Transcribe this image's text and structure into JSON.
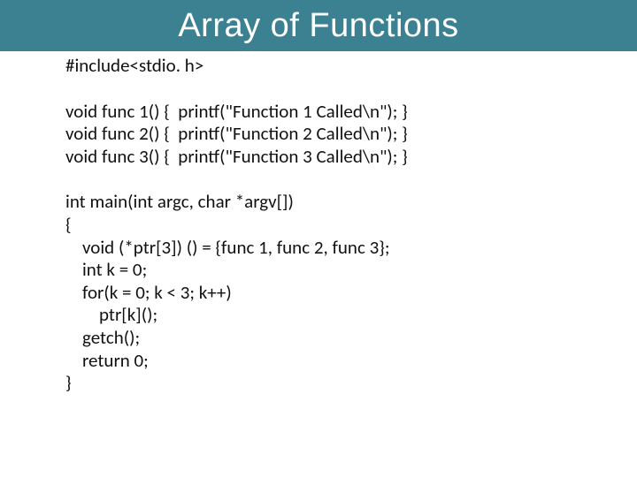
{
  "title": "Array of Functions",
  "code": {
    "include": "#include<stdio. h>",
    "funcs": "void func 1() {  printf(\"Function 1 Called\\n\"); }\nvoid func 2() {  printf(\"Function 2 Called\\n\"); }\nvoid func 3() {  printf(\"Function 3 Called\\n\"); }",
    "main": "int main(int argc, char *argv[])\n{\n    void (*ptr[3]) () = {func 1, func 2, func 3};\n    int k = 0;\n    for(k = 0; k < 3; k++)\n        ptr[k]();\n    getch();\n    return 0;\n}"
  }
}
